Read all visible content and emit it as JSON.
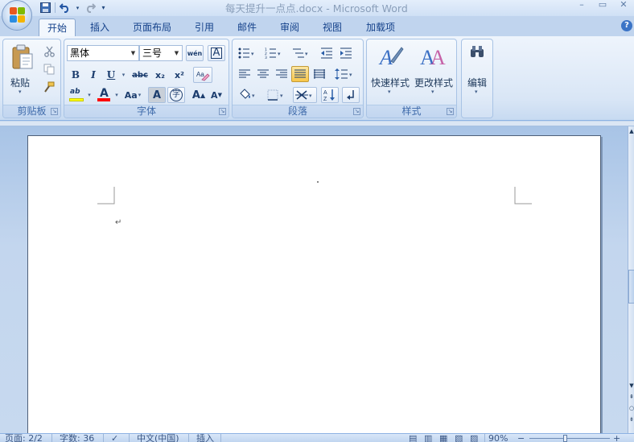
{
  "window": {
    "title": "每天提升一点点.docx - Microsoft Word",
    "minimize_glyph": "–",
    "maximize_glyph": "▭",
    "close_glyph": "✕"
  },
  "quick_access": {
    "save_icon": "save-icon",
    "undo_icon": "undo-icon",
    "redo_icon": "redo-icon",
    "customize_icon": "customize-icon"
  },
  "tabs": [
    {
      "label": "开始",
      "active": true
    },
    {
      "label": "插入",
      "active": false
    },
    {
      "label": "页面布局",
      "active": false
    },
    {
      "label": "引用",
      "active": false
    },
    {
      "label": "邮件",
      "active": false
    },
    {
      "label": "审阅",
      "active": false
    },
    {
      "label": "视图",
      "active": false
    },
    {
      "label": "加载项",
      "active": false
    }
  ],
  "help_label": "?",
  "groups": {
    "clipboard": {
      "label": "剪贴板",
      "paste_label": "粘贴"
    },
    "font": {
      "label": "字体",
      "font_name": "黑体",
      "font_size": "三号",
      "phonetic_label": "wén",
      "bold": "B",
      "italic": "I",
      "underline": "U",
      "strikethrough": "abc",
      "subscript": "x₂",
      "superscript": "x²",
      "highlight": "ab",
      "font_color": "A",
      "change_case": "Aa",
      "char_shading": "A",
      "enclose": "字",
      "grow": "A",
      "shrink": "A",
      "clear_format_label": "Aa"
    },
    "paragraph": {
      "label": "段落"
    },
    "styles": {
      "label": "样式",
      "quick_styles_label": "快速样式",
      "change_styles_label": "更改样式"
    },
    "editing": {
      "label": "编辑"
    }
  },
  "document": {
    "paragraph_mark": "↵"
  },
  "status": {
    "page": "页面: 2/2",
    "words": "字数: 36",
    "language": "中文(中国)",
    "mode": "插入",
    "zoom": "90%",
    "zoom_minus": "−",
    "zoom_plus": "+"
  },
  "colors": {
    "accent": "#15428b",
    "highlight": "#ffff00",
    "font_color": "#ff0000"
  }
}
